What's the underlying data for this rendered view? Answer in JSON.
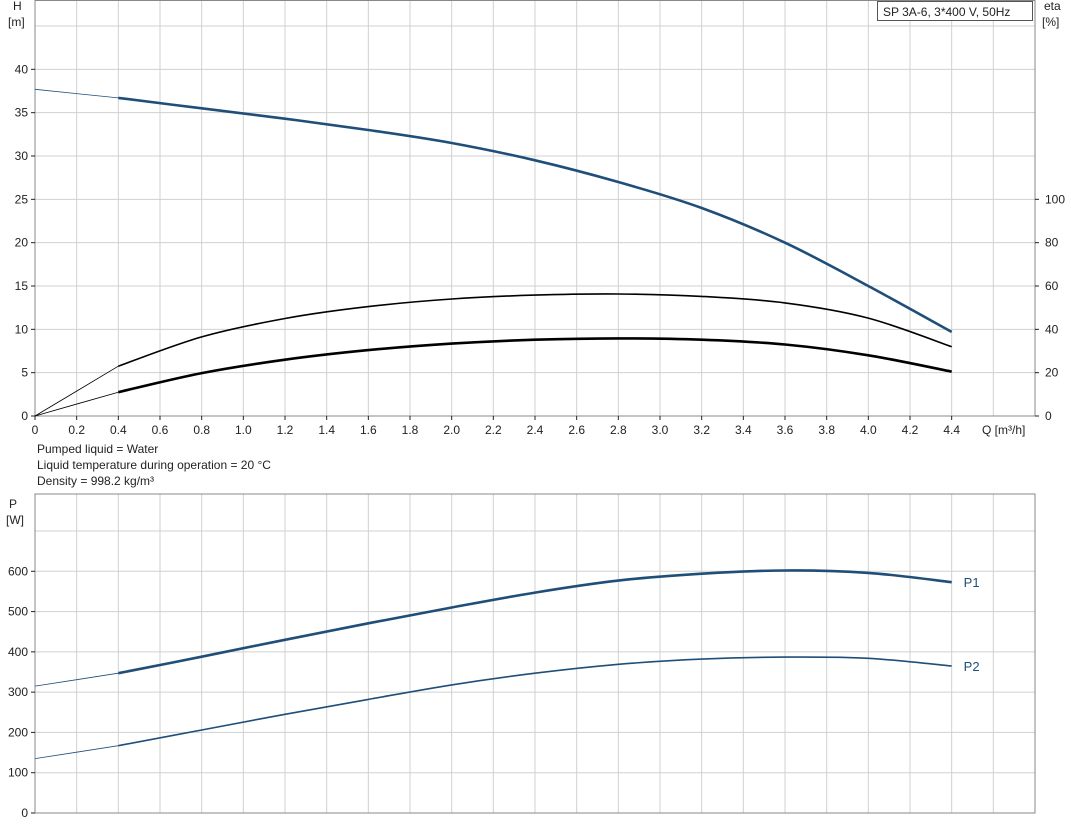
{
  "chart_data": [
    {
      "type": "line",
      "title": "SP 3A-6, 3*400 V, 50Hz",
      "xlabel": "Q [m³/h]",
      "ylabel_left": [
        "H",
        "[m]"
      ],
      "ylabel_right": [
        "eta",
        "[%]"
      ],
      "xlim": [
        0,
        4.8
      ],
      "ylim_left": [
        0,
        48
      ],
      "ylim_right": [
        0,
        100
      ],
      "grid": true,
      "x_ticks": [
        "0",
        "0.2",
        "0.4",
        "0.6",
        "0.8",
        "1.0",
        "1.2",
        "1.4",
        "1.6",
        "1.8",
        "2.0",
        "2.2",
        "2.4",
        "2.6",
        "2.8",
        "3.0",
        "3.2",
        "3.4",
        "3.6",
        "3.8",
        "4.0",
        "4.2",
        "4.4"
      ],
      "y_ticks_left": [
        "0",
        "5",
        "10",
        "15",
        "20",
        "25",
        "30",
        "35",
        "40"
      ],
      "y_ticks_right": [
        "0",
        "20",
        "40",
        "60",
        "80",
        "100"
      ],
      "series": [
        {
          "name": "H",
          "axis": "left",
          "color": "#1f4e79",
          "extrap_x": [
            0,
            0.4
          ],
          "extrap_y": [
            37.7,
            36.7
          ],
          "x": [
            0.4,
            0.8,
            1.2,
            1.6,
            2.0,
            2.4,
            2.8,
            3.2,
            3.6,
            4.0,
            4.4
          ],
          "y": [
            36.7,
            35.5,
            34.3,
            33.0,
            31.5,
            29.5,
            27.0,
            24.0,
            20.0,
            15.0,
            9.7
          ]
        },
        {
          "name": "",
          "axis": "right",
          "color": "#000000",
          "extrap_x": [
            0,
            0.4
          ],
          "extrap_y": [
            0,
            23
          ],
          "x": [
            0.4,
            0.8,
            1.2,
            1.6,
            2.0,
            2.4,
            2.8,
            3.2,
            3.6,
            4.0,
            4.4
          ],
          "y": [
            23,
            36.5,
            45,
            50.5,
            54,
            55.8,
            56.3,
            55.2,
            52.2,
            45.2,
            32
          ]
        },
        {
          "name": "",
          "axis": "right",
          "color": "#000000",
          "extrap_x": [
            0,
            0.4
          ],
          "extrap_y": [
            0,
            11
          ],
          "x": [
            0.4,
            0.8,
            1.2,
            1.6,
            2.0,
            2.4,
            2.8,
            3.2,
            3.6,
            4.0,
            4.4
          ],
          "y": [
            11,
            19.8,
            26,
            30.4,
            33.4,
            35.2,
            35.8,
            35.2,
            33.0,
            28.0,
            20.5
          ]
        }
      ]
    },
    {
      "type": "line",
      "xlim": [
        0,
        4.8
      ],
      "ylim": [
        0,
        700
      ],
      "ylabel": [
        "P",
        "[W]"
      ],
      "grid": true,
      "y_ticks": [
        "0",
        "100",
        "200",
        "300",
        "400",
        "500",
        "600"
      ],
      "series": [
        {
          "name": "P1",
          "color": "#1f4e79",
          "extrap_x": [
            0,
            0.4
          ],
          "extrap_y": [
            315,
            347
          ],
          "x": [
            0.4,
            0.8,
            1.2,
            1.6,
            2.0,
            2.4,
            2.8,
            3.2,
            3.6,
            4.0,
            4.4
          ],
          "y": [
            347,
            388,
            430,
            471,
            510,
            547,
            577,
            594,
            602,
            596,
            573
          ]
        },
        {
          "name": "P2",
          "color": "#1f4e79",
          "extrap_x": [
            0,
            0.4
          ],
          "extrap_y": [
            135,
            167
          ],
          "x": [
            0.4,
            0.8,
            1.2,
            1.6,
            2.0,
            2.4,
            2.8,
            3.2,
            3.6,
            4.0,
            4.4
          ],
          "y": [
            167,
            206,
            245,
            282,
            318,
            347,
            369,
            382,
            387,
            384,
            365
          ]
        }
      ]
    }
  ],
  "notes": [
    "Pumped liquid = Water",
    "Liquid temperature during operation = 20 °C",
    "Density = 998.2 kg/m³"
  ]
}
